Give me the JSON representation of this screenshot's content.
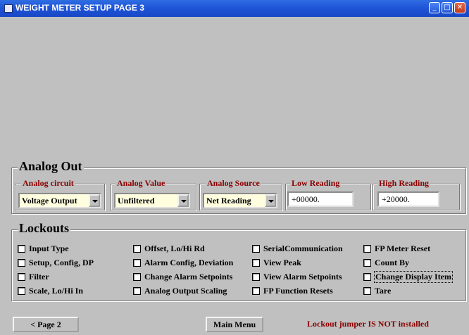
{
  "window": {
    "title": "WEIGHT METER SETUP  PAGE 3"
  },
  "analog_out": {
    "title": "Analog Out",
    "circuit": {
      "label": "Analog circuit",
      "value": "Voltage Output"
    },
    "value": {
      "label": "Analog Value",
      "value": "Unfiltered"
    },
    "source": {
      "label": "Analog Source",
      "value": "Net Reading"
    },
    "low": {
      "label": "Low Reading",
      "value": "+00000."
    },
    "high": {
      "label": "High Reading",
      "value": "+20000."
    }
  },
  "lockouts": {
    "title": "Lockouts",
    "items": [
      "Input Type",
      "Setup, Config, DP",
      "Filter",
      "Scale, Lo/Hi In",
      "Offset, Lo/Hi Rd",
      "Alarm Config, Deviation",
      "Change Alarm Setpoints",
      "Analog Output Scaling",
      "SerialCommunication",
      "View Peak",
      "View Alarm Setpoints",
      "FP Function Resets",
      "FP Meter Reset",
      "Count By",
      "Change Display Item",
      "Tare"
    ]
  },
  "footer": {
    "prev_label": "<  Page 2",
    "main_label": "Main Menu",
    "status": "Lockout  jumper IS NOT installed"
  },
  "colors": {
    "legend": "#8b0000",
    "titlebar": "#1f55d8",
    "field": "#ffffe0"
  }
}
